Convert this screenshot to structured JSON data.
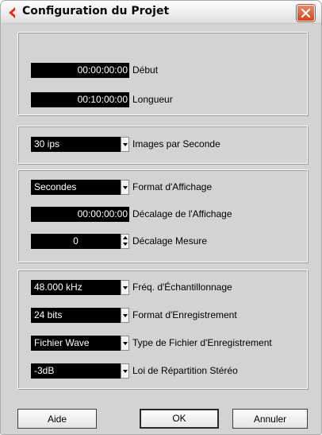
{
  "window": {
    "title": "Configuration du Projet"
  },
  "time_group": {
    "start": {
      "value": "00:00:00:00",
      "label": "Début"
    },
    "length": {
      "value": "00:10:00:00",
      "label": "Longueur"
    }
  },
  "frame_group": {
    "frame_rate": {
      "value": "30 ips",
      "label": "Images par Seconde"
    }
  },
  "display_group": {
    "display_format": {
      "value": "Secondes",
      "label": "Format d'Affichage"
    },
    "display_offset": {
      "value": "00:00:00:00",
      "label": "Décalage de l'Affichage"
    },
    "bar_offset": {
      "value": "0",
      "label": "Décalage Mesure"
    }
  },
  "audio_group": {
    "sample_rate": {
      "value": "48.000 kHz",
      "label": "Fréq. d'Échantillonnage"
    },
    "record_format": {
      "value": "24 bits",
      "label": "Format d'Enregistrement"
    },
    "file_type": {
      "value": "Fichier Wave",
      "label": "Type de Fichier d'Enregistrement"
    },
    "stereo_pan": {
      "value": "-3dB",
      "label": "Loi de Répartition Stéréo"
    }
  },
  "buttons": {
    "help": "Aide",
    "ok": "OK",
    "cancel": "Annuler"
  },
  "colors": {
    "field_bg": "#000000",
    "field_text": "#ffffff",
    "close_button": "#d4441c",
    "app_icon": "#e0301e"
  },
  "icons": {
    "app": "cubase-icon",
    "close": "close-icon"
  }
}
